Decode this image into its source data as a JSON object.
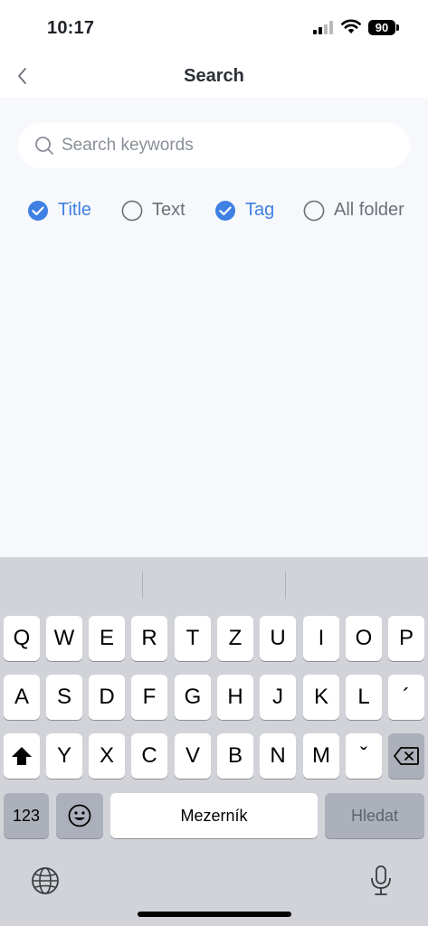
{
  "status": {
    "time": "10:17",
    "battery": "90"
  },
  "nav": {
    "title": "Search"
  },
  "search": {
    "placeholder": "Search keywords",
    "value": ""
  },
  "filters": [
    {
      "label": "Title",
      "checked": true
    },
    {
      "label": "Text",
      "checked": false
    },
    {
      "label": "Tag",
      "checked": true
    },
    {
      "label": "All folder",
      "checked": false
    }
  ],
  "colors": {
    "accent": "#3f80e4",
    "background": "#f7f8fc"
  },
  "keyboard": {
    "row1": [
      "Q",
      "W",
      "E",
      "R",
      "T",
      "Z",
      "U",
      "I",
      "O",
      "P"
    ],
    "row2": [
      "A",
      "S",
      "D",
      "F",
      "G",
      "H",
      "J",
      "K",
      "L",
      "´"
    ],
    "row3": [
      "Y",
      "X",
      "C",
      "V",
      "B",
      "N",
      "M",
      "ˇ"
    ],
    "numbers_label": "123",
    "space_label": "Mezerník",
    "return_label": "Hledat"
  }
}
